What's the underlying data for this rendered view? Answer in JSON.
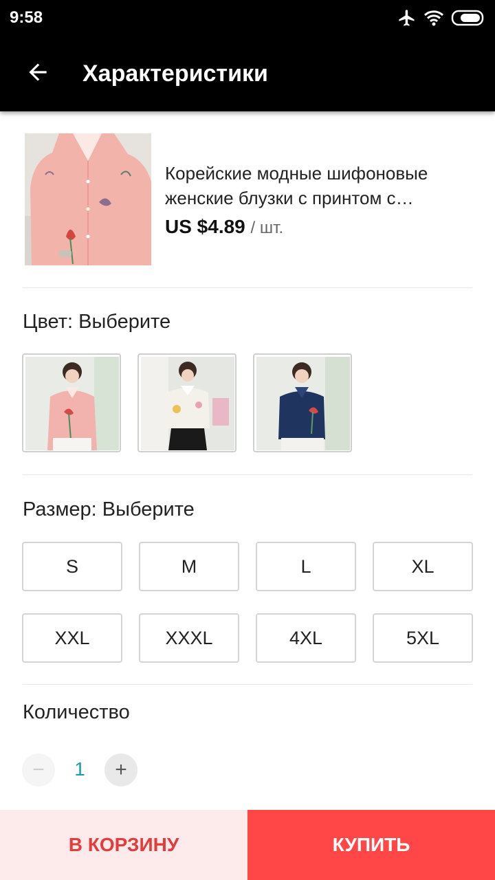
{
  "status_bar": {
    "time": "9:58"
  },
  "header": {
    "title": "Характеристики"
  },
  "product": {
    "title": "Корейские модные шифоновые женские блузки с принтом с отложным воротником",
    "price": "US $4.89",
    "unit": "/ шт."
  },
  "color": {
    "label": "Цвет: Выберите",
    "options": [
      {
        "name": "pink",
        "shirt_color": "#f2b2ad"
      },
      {
        "name": "white",
        "shirt_color": "#f4f1ea"
      },
      {
        "name": "navy",
        "shirt_color": "#1f3560"
      }
    ]
  },
  "size": {
    "label": "Размер: Выберите",
    "options": [
      "S",
      "M",
      "L",
      "XL",
      "XXL",
      "XXXL",
      "4XL",
      "5XL"
    ]
  },
  "quantity": {
    "label": "Количество",
    "value": "1",
    "minus": "−",
    "plus": "+"
  },
  "actions": {
    "cart": "В КОРЗИНУ",
    "buy": "КУПИТЬ"
  },
  "colors": {
    "accent": "#ff4747",
    "cart_bg": "#fdeaea",
    "cart_text": "#e23c3c",
    "qty": "#1a9bb4"
  }
}
